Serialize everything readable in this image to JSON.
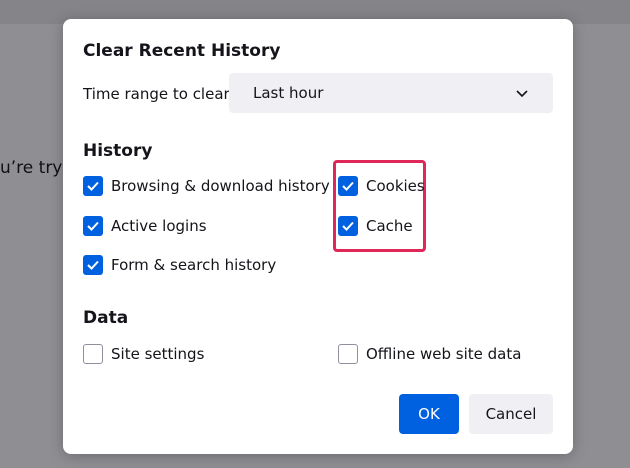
{
  "background": {
    "partial_text": "u’re tryi"
  },
  "dialog": {
    "title": "Clear Recent History",
    "time_range": {
      "label": "Time range to clear:",
      "selected": "Last hour"
    },
    "history": {
      "heading": "History",
      "items": [
        {
          "label": "Browsing & download history",
          "checked": true
        },
        {
          "label": "Active logins",
          "checked": true
        },
        {
          "label": "Form & search history",
          "checked": true
        },
        {
          "label": "Cookies",
          "checked": true
        },
        {
          "label": "Cache",
          "checked": true
        }
      ]
    },
    "data": {
      "heading": "Data",
      "items": [
        {
          "label": "Site settings",
          "checked": false
        },
        {
          "label": "Offline web site data",
          "checked": false
        }
      ]
    },
    "buttons": {
      "ok": "OK",
      "cancel": "Cancel"
    }
  },
  "colors": {
    "accent": "#0061e0",
    "highlight": "#e0275a",
    "overlay": "#8f8f93"
  }
}
